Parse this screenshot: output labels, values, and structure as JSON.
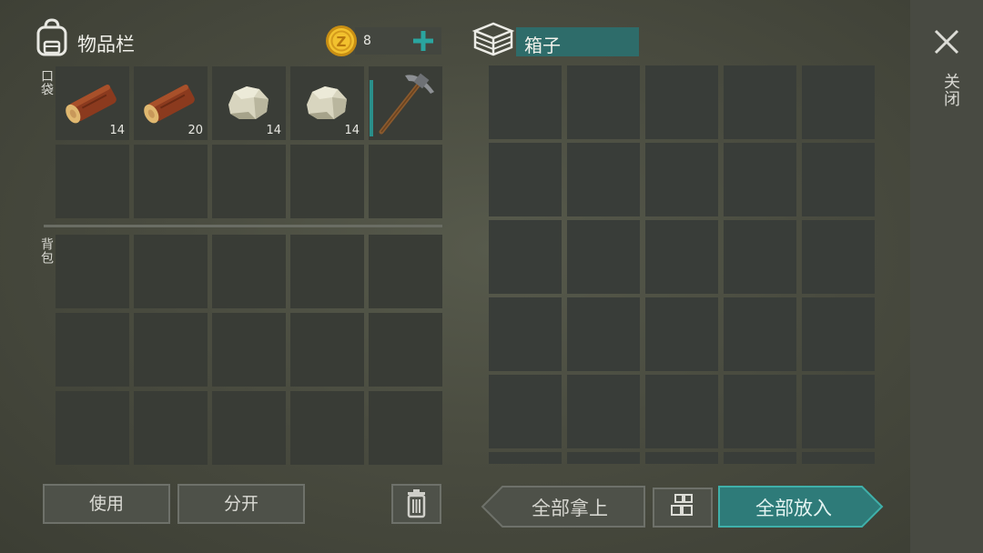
{
  "inventory": {
    "title": "物品栏",
    "coins": "8",
    "pocket_label": "口袋",
    "backpack_label": "背包",
    "pocket_items": [
      {
        "name": "wood-log",
        "qty": "14"
      },
      {
        "name": "wood-log",
        "qty": "20"
      },
      {
        "name": "stone",
        "qty": "14"
      },
      {
        "name": "stone",
        "qty": "14"
      },
      {
        "name": "pickaxe",
        "qty": ""
      }
    ],
    "use_label": "使用",
    "split_label": "分开"
  },
  "box": {
    "title": "箱子",
    "take_all_label": "全部拿上",
    "put_all_label": "全部放入"
  },
  "close_label": "关闭",
  "colors": {
    "accent": "#2a9a96",
    "accent_bg": "#2e6c6a",
    "slot": "#393c36",
    "background": "#4a4c40"
  }
}
